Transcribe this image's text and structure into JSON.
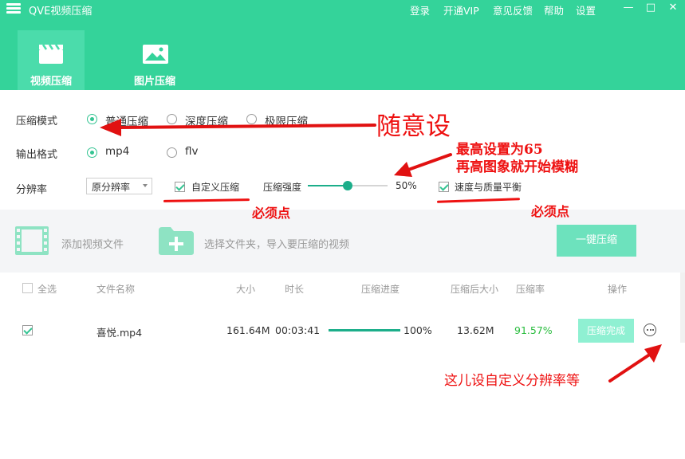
{
  "app": {
    "title": "QVE视频压缩",
    "menu": [
      "登录",
      "开通VIP",
      "意见反馈",
      "帮助",
      "设置"
    ],
    "window_controls": [
      "—",
      "□",
      "✕"
    ]
  },
  "tabs": [
    {
      "label": "视频压缩",
      "active": true,
      "icon": "clapperboard-icon"
    },
    {
      "label": "图片压缩",
      "active": false,
      "icon": "image-icon"
    }
  ],
  "settings": {
    "compress_mode": {
      "label": "压缩模式",
      "options": [
        "普通压缩",
        "深度压缩",
        "极限压缩"
      ],
      "selected": 0
    },
    "output_format": {
      "label": "输出格式",
      "options": [
        "mp4",
        "flv"
      ],
      "selected": 0
    },
    "resolution": {
      "label": "分辨率",
      "value": "原分辨率"
    },
    "custom_compress": {
      "label": "自定义压缩",
      "checked": true
    },
    "strength": {
      "label": "压缩强度",
      "value_text": "50%",
      "value": 0.5
    },
    "speed_quality": {
      "label": "速度与质量平衡",
      "checked": true
    }
  },
  "toolbar": {
    "add_video": "添加视频文件",
    "select_folder": "选择文件夹，导入要压缩的视频",
    "compress_all": "一键压缩"
  },
  "table": {
    "headers": {
      "select_all": "全选",
      "name": "文件名称",
      "size": "大小",
      "duration": "时长",
      "progress": "压缩进度",
      "compressed_size": "压缩后大小",
      "ratio": "压缩率",
      "actions": "操作"
    },
    "rows": [
      {
        "checked": true,
        "name": "喜悦.mp4",
        "size": "161.64M",
        "duration": "00:03:41",
        "progress_text": "100%",
        "progress": 1.0,
        "compressed_size": "13.62M",
        "ratio": "91.57%",
        "action": "压缩完成"
      }
    ]
  },
  "annotations": {
    "anything": "随意设",
    "max_line1": "最高设置为65",
    "max_line2": "再高图象就开始模糊",
    "required1": "必须点",
    "required2": "必须点",
    "resolution_hint": "这儿设自定义分辨率等"
  },
  "colors": {
    "brand": "#34d39a",
    "accent": "#1cae8a",
    "annotation": "#e11111",
    "ratio": "#2bbd3f"
  }
}
